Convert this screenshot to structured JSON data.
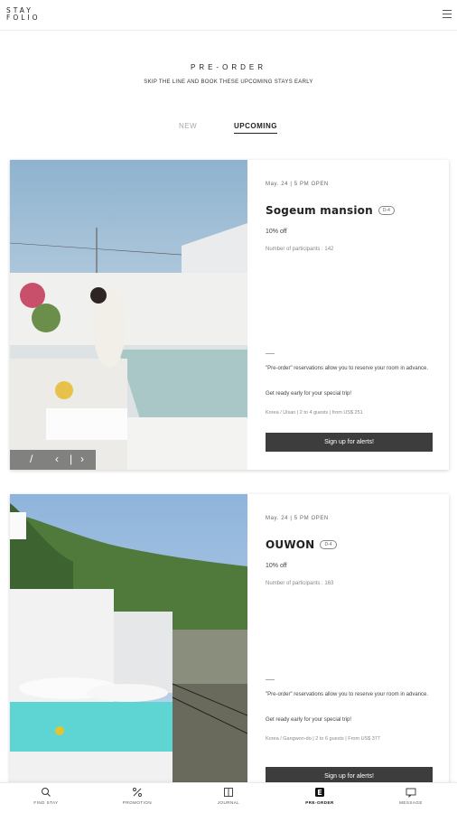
{
  "header": {
    "logo_line1": "STAY",
    "logo_line2": "FOLIO"
  },
  "hero": {
    "title": "PRE-ORDER",
    "subtitle": "SKIP THE LINE AND BOOK THESE UPCOMING STAYS EARLY"
  },
  "tabs": [
    {
      "label": "NEW",
      "active": false
    },
    {
      "label": "UPCOMING",
      "active": true
    }
  ],
  "cards": [
    {
      "open_date": "May. 24 | 5 PM OPEN",
      "name": "Sogeum mansion",
      "dday": "D-4",
      "discount": "10% off",
      "participants": "Number of participants : 142",
      "desc_1": "\"Pre-order\" reservations allow you to reserve your room in advance.",
      "desc_2": "Get ready early for your special trip!",
      "meta": "Korea / Ulsan  |  2 to 4 guests  |  from US$ 251",
      "button": "Sign up for alerts!"
    },
    {
      "open_date": "May. 24 | 5 PM OPEN",
      "name": "OUWON",
      "dday": "D-4",
      "discount": "10% off",
      "participants": "Number of participants : 163",
      "desc_1": "\"Pre-order\" reservations allow you to reserve your room in advance.",
      "desc_2": "Get ready early for your special trip!",
      "meta": "Korea / Gangwon-do  |  2 to 6 guests  |  From US$ 377",
      "button": "Sign up for alerts!"
    }
  ],
  "bottom_nav": [
    {
      "label": "FIND STAY",
      "icon": "search-icon",
      "active": false
    },
    {
      "label": "PROMOTION",
      "icon": "percent-icon",
      "active": false
    },
    {
      "label": "JOURNAL",
      "icon": "journal-icon",
      "active": false
    },
    {
      "label": "PRE-ORDER",
      "icon": "preorder-icon",
      "active": true
    },
    {
      "label": "MESSAGE",
      "icon": "message-icon",
      "active": false
    }
  ]
}
